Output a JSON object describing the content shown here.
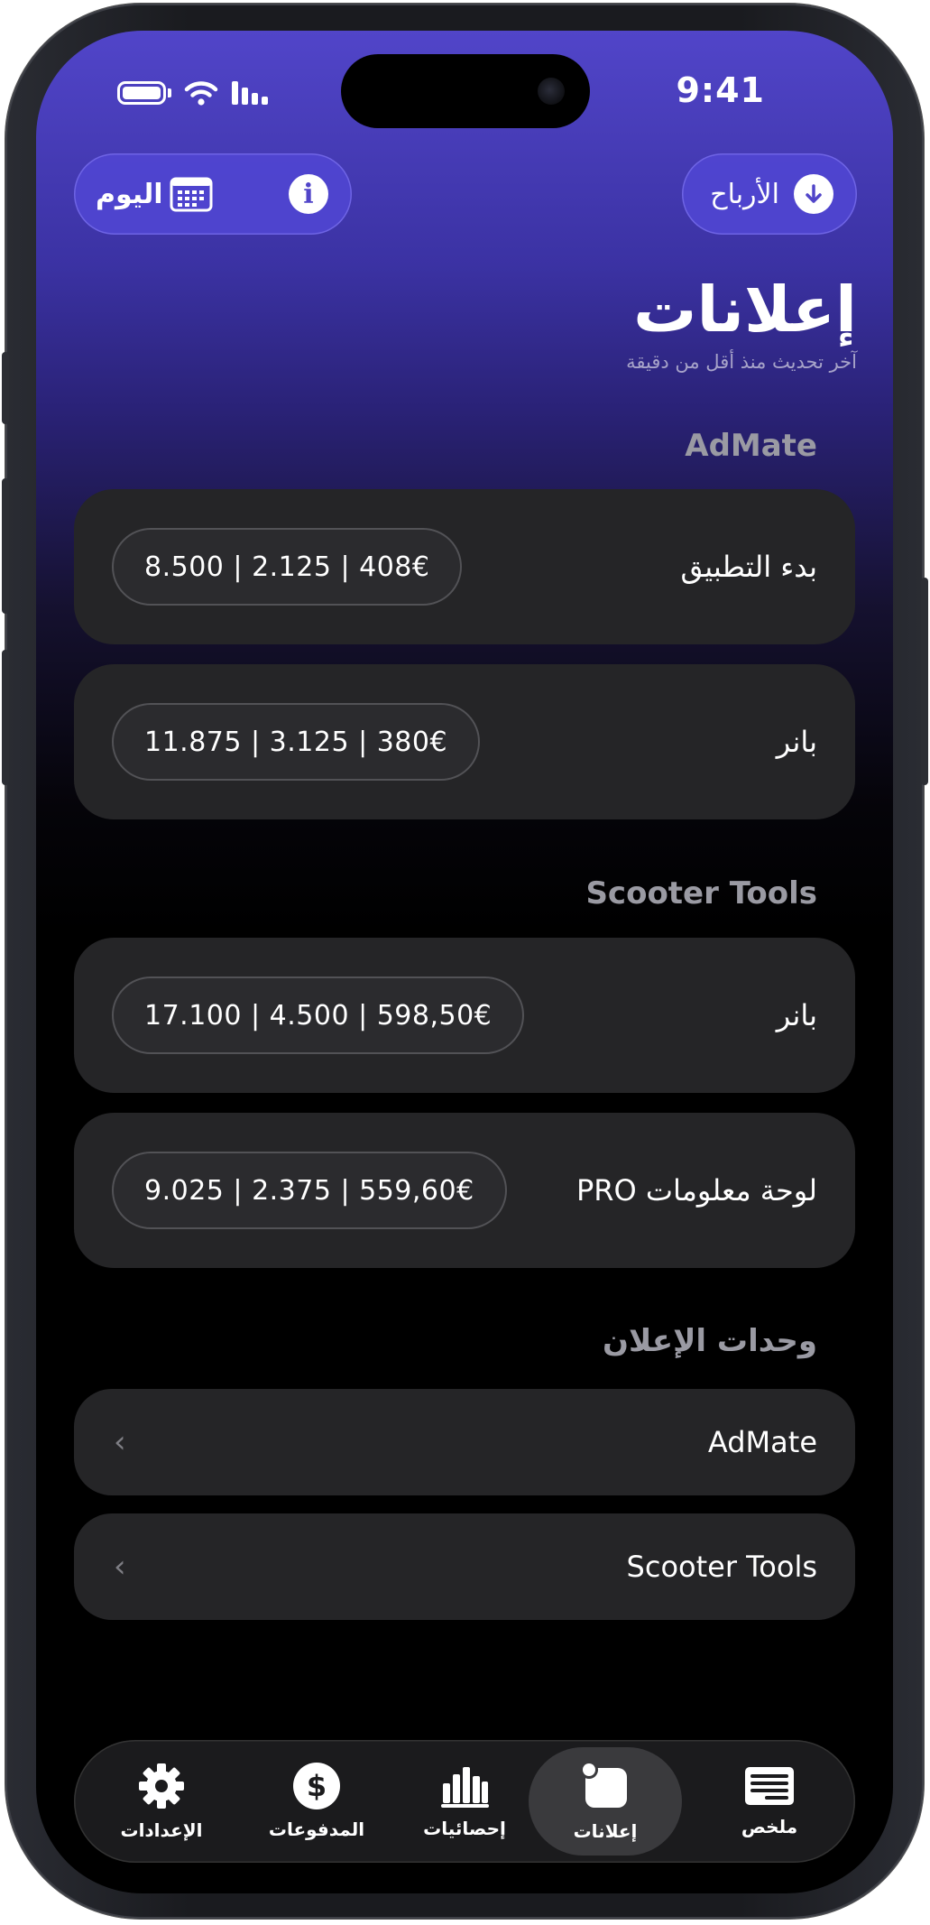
{
  "status_bar": {
    "time": "9:41"
  },
  "header": {
    "today_label": "اليوم",
    "earnings_label": "الأرباح",
    "title": "إعلانات",
    "subtitle": "آخر تحديث منذ أقل من دقيقة"
  },
  "sections": [
    {
      "title": "AdMate",
      "rows": [
        {
          "label": "بدء التطبيق",
          "stats": "8.500 | 2.125 | 408€"
        },
        {
          "label": "بانر",
          "stats": "11.875 | 3.125 | 380€"
        }
      ]
    },
    {
      "title": "Scooter Tools",
      "rows": [
        {
          "label": "بانر",
          "stats": "17.100 | 4.500 | 598,50€"
        },
        {
          "label": "لوحة معلومات PRO",
          "stats": "9.025 | 2.375 | 559,60€"
        }
      ]
    }
  ],
  "ad_units": {
    "title": "وحدات الإعلان",
    "items": [
      {
        "label": "AdMate"
      },
      {
        "label": "Scooter Tools"
      }
    ]
  },
  "tabbar": {
    "items": [
      {
        "label": "الإعدادات",
        "icon": "gear-icon"
      },
      {
        "label": "المدفوعات",
        "icon": "dollar-icon"
      },
      {
        "label": "إحصائيات",
        "icon": "bar-chart-icon"
      },
      {
        "label": "إعلانات",
        "icon": "ads-icon",
        "active": true
      },
      {
        "label": "ملخص",
        "icon": "summary-icon"
      }
    ]
  },
  "colors": {
    "accent": "#5145c9",
    "card": "#252527",
    "section_title": "#9a9aa3"
  }
}
